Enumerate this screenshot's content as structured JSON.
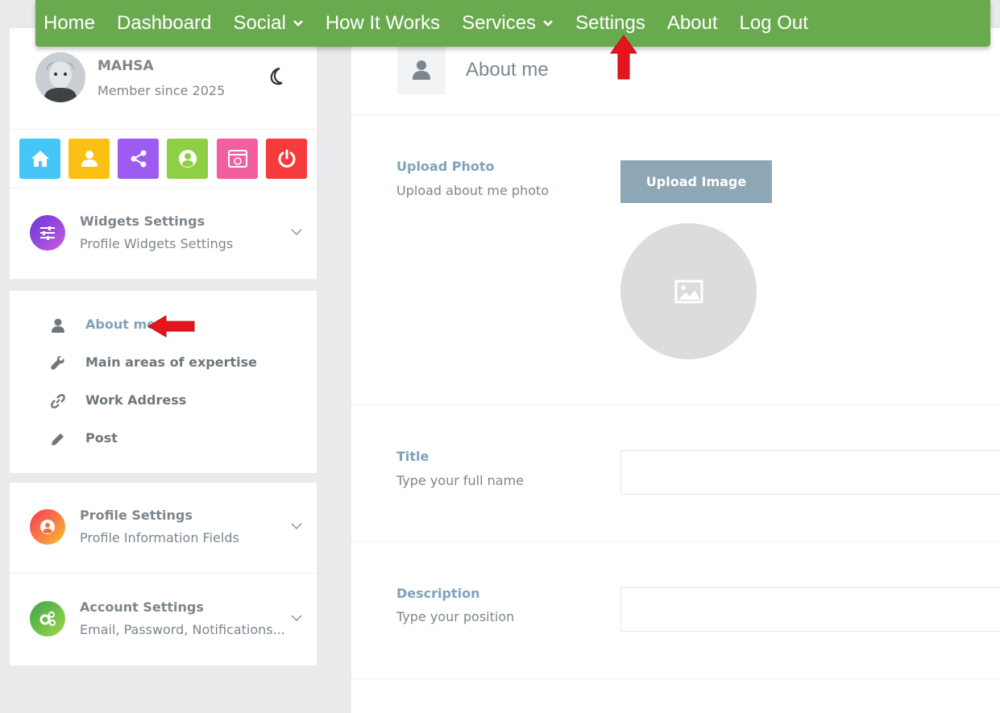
{
  "nav": {
    "items": [
      {
        "label": "Home",
        "dropdown": false
      },
      {
        "label": "Dashboard",
        "dropdown": false
      },
      {
        "label": "Social",
        "dropdown": true
      },
      {
        "label": "How It Works",
        "dropdown": false
      },
      {
        "label": "Services",
        "dropdown": true
      },
      {
        "label": "Settings",
        "dropdown": false
      },
      {
        "label": "About",
        "dropdown": false
      },
      {
        "label": "Log Out",
        "dropdown": false
      }
    ],
    "bg_color": "#6aaa4f"
  },
  "profile": {
    "name": "MAHSA",
    "member_since": "Member since 2025",
    "theme_toggle_icon": "moon-icon"
  },
  "quick_actions": [
    {
      "icon": "home-icon",
      "color": "#45c6f7"
    },
    {
      "icon": "user-icon",
      "color": "#fcc015"
    },
    {
      "icon": "share-icon",
      "color": "#9e5bf2"
    },
    {
      "icon": "user-circle-icon",
      "color": "#8fcf45"
    },
    {
      "icon": "browser-window-icon",
      "color": "#f25e9e"
    },
    {
      "icon": "power-icon",
      "color": "#f53b3b"
    }
  ],
  "accordions": {
    "widgets": {
      "title": "Widgets Settings",
      "subtitle": "Profile Widgets Settings",
      "icon": "sliders-icon"
    },
    "profile": {
      "title": "Profile Settings",
      "subtitle": "Profile Information Fields",
      "icon": "user-circle-icon"
    },
    "account": {
      "title": "Account Settings",
      "subtitle": "Email, Password, Notifications...",
      "icon": "cogs-icon"
    }
  },
  "submenu": {
    "items": [
      {
        "label": "About me",
        "icon": "user-icon",
        "active": true
      },
      {
        "label": "Main areas of expertise",
        "icon": "wrench-icon",
        "active": false
      },
      {
        "label": "Work Address",
        "icon": "link-icon",
        "active": false
      },
      {
        "label": "Post",
        "icon": "pencil-icon",
        "active": false
      }
    ]
  },
  "main": {
    "header_title": "About me",
    "upload": {
      "label": "Upload Photo",
      "sub": "Upload about me photo",
      "button": "Upload Image"
    },
    "title_field": {
      "label": "Title",
      "sub": "Type your full name",
      "value": "",
      "placeholder": ""
    },
    "description_field": {
      "label": "Description",
      "sub": "Type your position",
      "value": "",
      "placeholder": ""
    }
  },
  "accent_colors": {
    "label_blue": "#7ea2bb",
    "annotation_red": "#e8141d"
  }
}
